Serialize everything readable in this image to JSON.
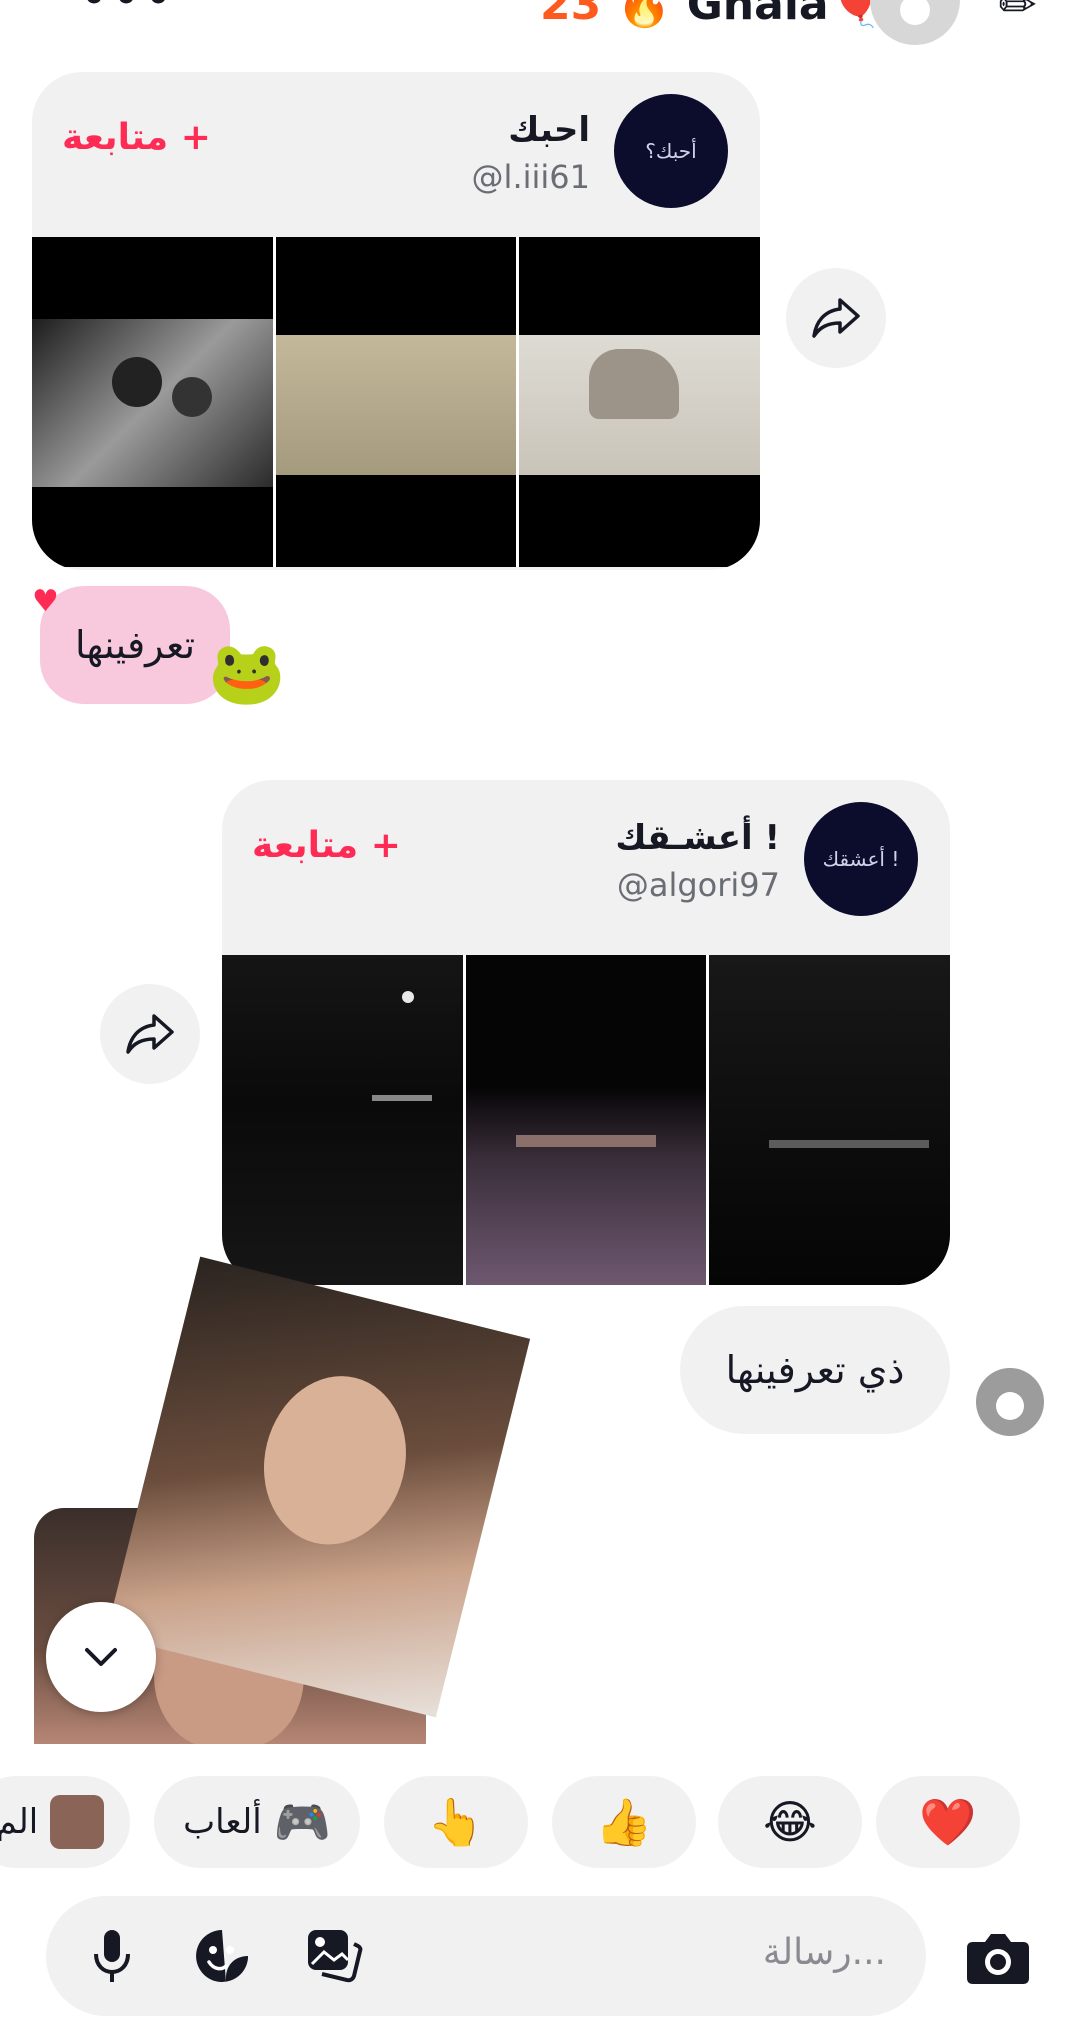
{
  "header": {
    "menu_icon": "more-dots-icon",
    "streak_count": "23",
    "streak_icon": "🔥",
    "title": "Ghala",
    "title_emoji": "🎈",
    "title_suffix": ".",
    "edit_icon": "edit-icon"
  },
  "messages": {
    "card1": {
      "name": "احبك",
      "handle": "@l.iii61",
      "follow_label": "متابعة +",
      "avatar_text": "أحبك؟"
    },
    "msg1": {
      "text": "تعرفينها",
      "reaction_heart": "♥",
      "sticker": "🐸"
    },
    "card2": {
      "name": "أعشـقك !",
      "handle": "@algori97",
      "follow_label": "متابعة +",
      "avatar_text": "أعشقك !"
    },
    "msg2": {
      "text": "ذي تعرفينها"
    }
  },
  "quick_replies": {
    "heart": "❤️",
    "laugh": "😂",
    "thumbs_up": "👍",
    "point": "👆",
    "games_label": "ألعاب",
    "games_icon": "🎮",
    "partial_label": "الم"
  },
  "composer": {
    "placeholder": "رسالة..."
  },
  "colors": {
    "accent": "#fe2c55",
    "streak": "#fe5a1d",
    "bubble_pink": "#f8c8dc",
    "card_bg": "#f1f1f2"
  }
}
